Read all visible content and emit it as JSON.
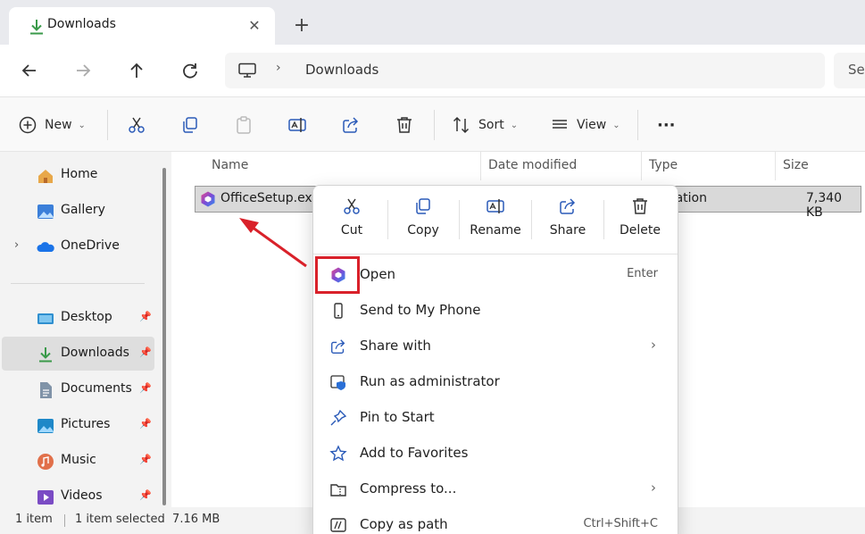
{
  "window": {
    "tab_title": "Downloads",
    "close_glyph": "✕",
    "newtab_glyph": "+"
  },
  "address": {
    "separator": "›",
    "path": "Downloads",
    "search_placeholder": "Se"
  },
  "toolbar": {
    "new_label": "New",
    "sort_label": "Sort",
    "view_label": "View",
    "more_glyph": "···",
    "chevron": "⌄"
  },
  "sidebar": {
    "items": [
      {
        "label": "Home",
        "icon": "home-icon"
      },
      {
        "label": "Gallery",
        "icon": "gallery-icon"
      },
      {
        "label": "OneDrive",
        "icon": "onedrive-icon"
      },
      {
        "label": "Desktop",
        "icon": "desktop-icon"
      },
      {
        "label": "Downloads",
        "icon": "download-icon"
      },
      {
        "label": "Documents",
        "icon": "documents-icon"
      },
      {
        "label": "Pictures",
        "icon": "pictures-icon"
      },
      {
        "label": "Music",
        "icon": "music-icon"
      },
      {
        "label": "Videos",
        "icon": "videos-icon"
      }
    ],
    "expand_glyph": "›",
    "pin_glyph": "📌"
  },
  "file_list": {
    "columns": [
      "Name",
      "Date modified",
      "Type",
      "Size"
    ],
    "rows": [
      {
        "name": "OfficeSetup.exe",
        "type": "ication",
        "size": "7,340 KB"
      }
    ]
  },
  "status": {
    "count": "1 item",
    "selection": "1 item selected  7.16 MB"
  },
  "context_menu": {
    "quick_actions": [
      "Cut",
      "Copy",
      "Rename",
      "Share",
      "Delete"
    ],
    "items": [
      {
        "label": "Open",
        "shortcut": "Enter",
        "icon": "office-icon"
      },
      {
        "label": "Send to My Phone",
        "shortcut": "",
        "icon": "phone-icon"
      },
      {
        "label": "Share with",
        "shortcut": "",
        "icon": "share-icon",
        "submenu": true
      },
      {
        "label": "Run as administrator",
        "shortcut": "",
        "icon": "shield-icon"
      },
      {
        "label": "Pin to Start",
        "shortcut": "",
        "icon": "pin-icon"
      },
      {
        "label": "Add to Favorites",
        "shortcut": "",
        "icon": "star-icon"
      },
      {
        "label": "Compress to...",
        "shortcut": "",
        "icon": "zip-icon",
        "submenu": true
      },
      {
        "label": "Copy as path",
        "shortcut": "Ctrl+Shift+C",
        "icon": "path-icon"
      }
    ],
    "submenu_glyph": "›"
  },
  "colors": {
    "highlight": "#d9212a",
    "accent_green": "#3a9a4a",
    "office_purple": "#7b4bd6"
  }
}
